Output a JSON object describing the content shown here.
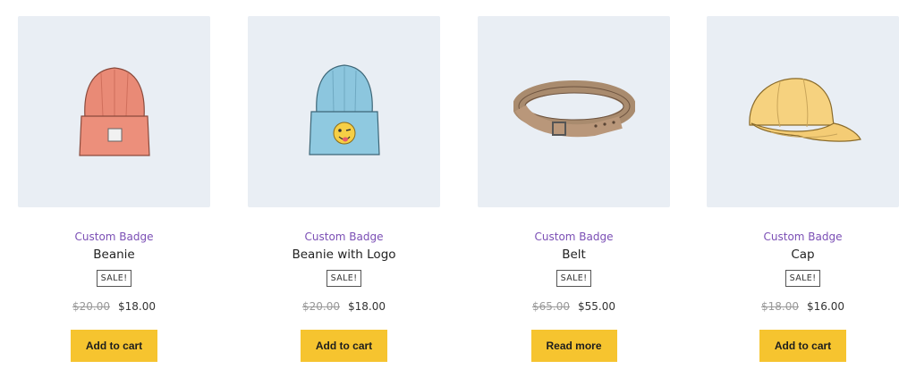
{
  "products": [
    {
      "badge": "Custom Badge",
      "name": "Beanie",
      "sale_label": "SALE!",
      "old_price": "$20.00",
      "price": "$18.00",
      "button": "Add to cart",
      "image_icon": "red-beanie-image"
    },
    {
      "badge": "Custom Badge",
      "name": "Beanie with Logo",
      "sale_label": "SALE!",
      "old_price": "$20.00",
      "price": "$18.00",
      "button": "Add to cart",
      "image_icon": "blue-beanie-logo-image"
    },
    {
      "badge": "Custom Badge",
      "name": "Belt",
      "sale_label": "SALE!",
      "old_price": "$65.00",
      "price": "$55.00",
      "button": "Read more",
      "image_icon": "belt-image"
    },
    {
      "badge": "Custom Badge",
      "name": "Cap",
      "sale_label": "SALE!",
      "old_price": "$18.00",
      "price": "$16.00",
      "button": "Add to cart",
      "image_icon": "cap-image"
    }
  ],
  "colors": {
    "badge": "#7b4fb5",
    "button": "#f6c42f",
    "thumb_bg": "#e9eef4"
  }
}
